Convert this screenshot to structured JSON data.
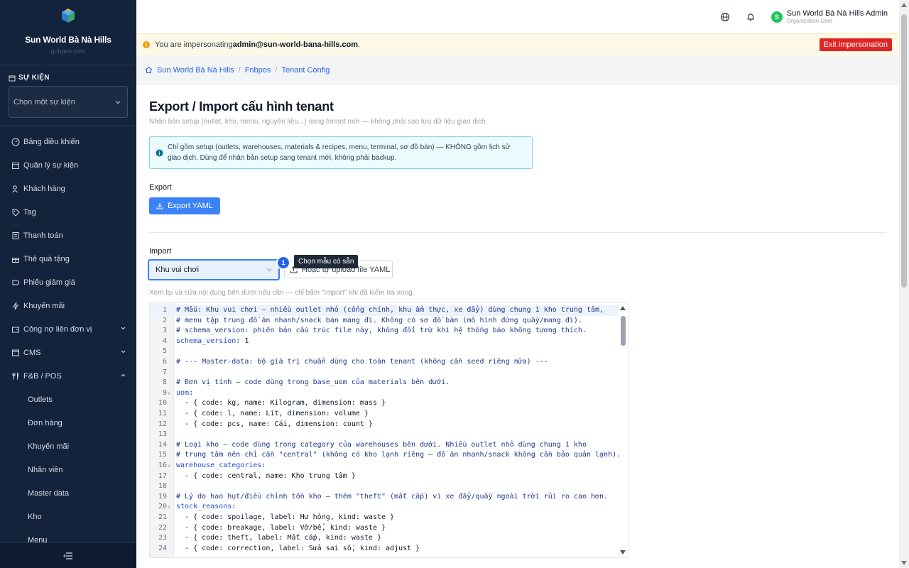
{
  "sidebar": {
    "brand_name": "Sun World Bà Nà Hills",
    "brand_sub": "gnbpos.com",
    "event_section_label": "SỰ KIỆN",
    "event_placeholder": "Chọn một sự kiện",
    "items": [
      {
        "label": "Bảng điều khiển",
        "icon": "gauge-icon"
      },
      {
        "label": "Quản lý sự kiện",
        "icon": "calendar-icon"
      },
      {
        "label": "Khách hàng",
        "icon": "user-icon"
      },
      {
        "label": "Tag",
        "icon": "tag-icon"
      },
      {
        "label": "Thanh toán",
        "icon": "receipt-icon"
      },
      {
        "label": "Thẻ quà tặng",
        "icon": "gift-icon"
      },
      {
        "label": "Phiếu giảm giá",
        "icon": "ticket-icon"
      },
      {
        "label": "Khuyến mãi",
        "icon": "bolt-icon"
      },
      {
        "label": "Công nợ liên đơn vị",
        "icon": "wallet-icon"
      },
      {
        "label": "CMS",
        "icon": "cms-icon"
      },
      {
        "label": "F&B / POS",
        "icon": "utensils-icon"
      }
    ],
    "sub_items": [
      "Outlets",
      "Đơn hàng",
      "Khuyến mãi",
      "Nhân viên",
      "Master data",
      "Kho",
      "Menu"
    ]
  },
  "topbar": {
    "user_initial": "S",
    "user_name": "Sun World Bà Nà Hills Admin",
    "user_role": "Organization User"
  },
  "banner": {
    "prefix": "You are impersonating ",
    "email": "admin@sun-world-bana-hills.com",
    "suffix": ".",
    "exit_label": "Exit impersonation"
  },
  "breadcrumb": [
    "Sun World Bà Nà Hills",
    "Fnbpos",
    "Tenant Config"
  ],
  "page": {
    "title": "Export / Import cấu hình tenant",
    "subtitle": "Nhân bản setup (outlet, kho, menu, nguyên liệu...) sang tenant mới — không phải sao lưu dữ liệu giao dịch.",
    "info_line1": "Chỉ gồm setup (outlets, warehouses, materials & recipes, menu, terminal, sơ đồ bàn) — KHÔNG gồm lịch sử",
    "info_line2": "giao dịch. Dùng để nhân bản setup sang tenant mới, không phải backup.",
    "export_label": "Export",
    "export_button": "Export YAML",
    "import_label": "Import",
    "template_selected": "Khu vui chơi",
    "step_number": "1",
    "tooltip": "Chọn mẫu có sẵn",
    "upload_button": "Hoặc tự upload file YAML",
    "hint": "Xem lại và sửa nội dung bên dưới nếu cần — chỉ bấm \"Import\" khi đã kiểm tra xong."
  },
  "editor": {
    "lines": [
      {
        "n": "1",
        "t": "# Mẫu: Khu vui chơi — nhiều outlet nhỏ (cổng chính, khu ẩm thực, xe đẩy) dùng chung 1 kho trung tâm,",
        "k": "c"
      },
      {
        "n": "2",
        "t": "# menu tập trung đồ ăn nhanh/snack bán mang đi. Không có sơ đồ bàn (mô hình đứng quầy/mang đi).",
        "k": "c"
      },
      {
        "n": "3",
        "t": "# schema_version: phiên bản cấu trúc file này, không đổi trừ khi hệ thống báo không tương thích.",
        "k": "c"
      },
      {
        "n": "4",
        "key": "schema_version",
        "rest": ": 1"
      },
      {
        "n": "5",
        "t": ""
      },
      {
        "n": "6",
        "t": "# --- Master-data: bộ giá trị chuẩn dùng cho toàn tenant (không cần seed riêng nữa) ---",
        "k": "c"
      },
      {
        "n": "7",
        "t": ""
      },
      {
        "n": "8",
        "t": "# Đơn vị tính — code dùng trong base_uom của materials bên dưới.",
        "k": "c"
      },
      {
        "n": "9",
        "key": "uom",
        "rest": ":",
        "fold": true
      },
      {
        "n": "10",
        "t": "  - { code: kg, name: Kilogram, dimension: mass }",
        "k": "m"
      },
      {
        "n": "11",
        "t": "  - { code: l, name: Lít, dimension: volume }",
        "k": "m"
      },
      {
        "n": "12",
        "t": "  - { code: pcs, name: Cái, dimension: count }",
        "k": "m"
      },
      {
        "n": "13",
        "t": ""
      },
      {
        "n": "14",
        "t": "# Loại kho — code dùng trong category của warehouses bên dưới. Nhiều outlet nhỏ dùng chung 1 kho",
        "k": "c"
      },
      {
        "n": "15",
        "t": "# trung tâm nên chỉ cần \"central\" (không có kho lạnh riêng — đồ ăn nhanh/snack không cần bảo quản lạnh).",
        "k": "c"
      },
      {
        "n": "16",
        "key": "warehouse_categories",
        "rest": ":",
        "fold": true
      },
      {
        "n": "17",
        "t": "  - { code: central, name: Kho trung tâm }",
        "k": "m"
      },
      {
        "n": "18",
        "t": ""
      },
      {
        "n": "19",
        "t": "# Lý do hao hụt/điều chỉnh tồn kho — thêm \"theft\" (mất cắp) vì xe đẩy/quầy ngoài trời rủi ro cao hơn.",
        "k": "c"
      },
      {
        "n": "20",
        "key": "stock_reasons",
        "rest": ":",
        "fold": true
      },
      {
        "n": "21",
        "t": "  - { code: spoilage, label: Hư hỏng, kind: waste }",
        "k": "m"
      },
      {
        "n": "22",
        "t": "  - { code: breakage, label: Vỡ/bể, kind: waste }",
        "k": "m"
      },
      {
        "n": "23",
        "t": "  - { code: theft, label: Mất cắp, kind: waste }",
        "k": "m"
      },
      {
        "n": "24",
        "t": "  - { code: correction, label: Sửa sai số, kind: adjust }",
        "k": "m"
      }
    ]
  },
  "colors": {
    "accent": "#3b82f6",
    "sidebar": "#14233c",
    "danger": "#e02424"
  }
}
